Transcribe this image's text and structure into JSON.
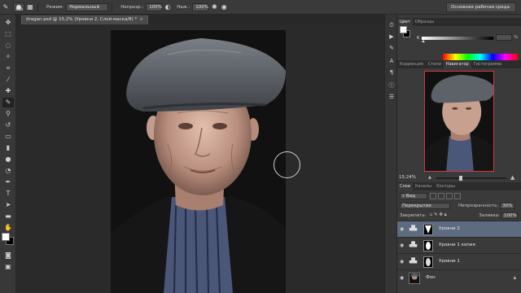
{
  "options_bar": {
    "brush_size": "600",
    "mode_label": "Режим:",
    "mode_value": "Нормальный",
    "opacity_label": "Непрозр.:",
    "opacity_value": "100%",
    "flow_label": "Наж.:",
    "flow_value": "100%",
    "workspace": "Основная рабочая среда"
  },
  "document": {
    "tab_title": "dragan.psd @ 15,2% (Уровни 2, Слой-маска/8) *",
    "close_glyph": "×"
  },
  "color_panel": {
    "tabs": [
      "Цвет",
      "Образцы"
    ],
    "k_label": "K",
    "k_value": "",
    "k_pct": "%"
  },
  "navigator_panel": {
    "tabs": [
      "Коррекция",
      "Стили",
      "Навигатор",
      "Гистограмма"
    ],
    "zoom": "15,24%"
  },
  "layers_panel": {
    "tabs": [
      "Слои",
      "Каналы",
      "Контуры"
    ],
    "filter_label": "Вид",
    "blend_mode": "Перекрытие",
    "opacity_label": "Непрозрачность:",
    "opacity_value": "30%",
    "lock_label": "Закрепить:",
    "fill_label": "Заливка:",
    "fill_value": "100%",
    "layers": [
      {
        "name": "Уровни 2",
        "selected": true
      },
      {
        "name": "Уровни 1 копия",
        "selected": false
      },
      {
        "name": "Уровни 1",
        "selected": false
      },
      {
        "name": "Фон",
        "selected": false
      }
    ]
  }
}
